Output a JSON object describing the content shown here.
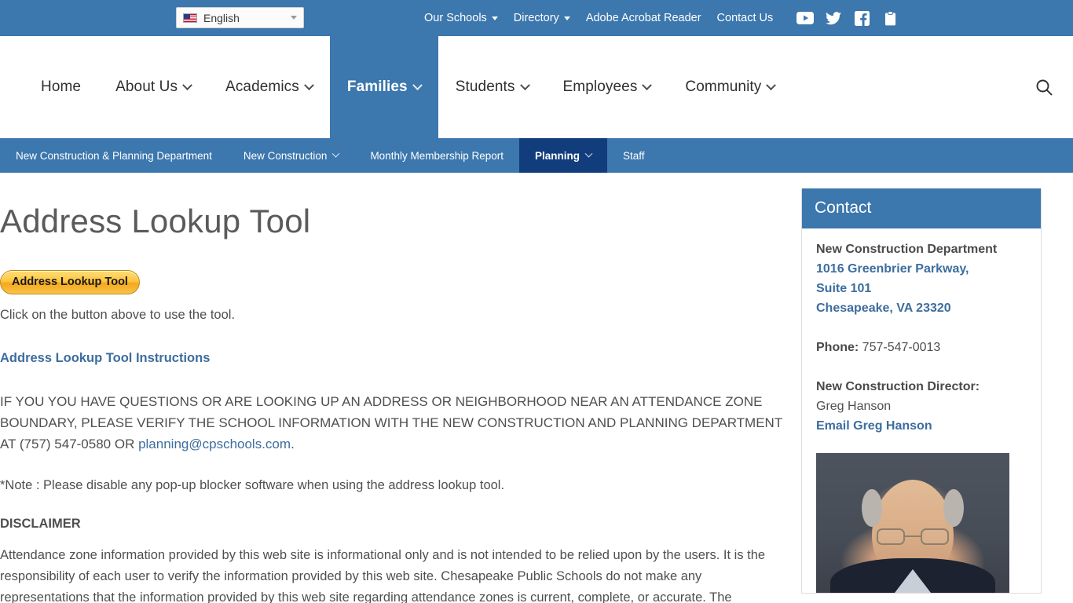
{
  "topbar": {
    "language": {
      "label": "English",
      "flag_icon": "us-flag-icon"
    },
    "links": [
      {
        "label": "Our Schools",
        "has_dropdown": true
      },
      {
        "label": "Directory",
        "has_dropdown": true
      },
      {
        "label": "Adobe Acrobat Reader",
        "has_dropdown": false
      },
      {
        "label": "Contact Us",
        "has_dropdown": false
      }
    ],
    "social": [
      {
        "name": "youtube-icon"
      },
      {
        "name": "twitter-icon"
      },
      {
        "name": "facebook-icon"
      },
      {
        "name": "clipboard-icon"
      }
    ]
  },
  "mainnav": {
    "items": [
      {
        "label": "Home",
        "has_dropdown": false,
        "active": false
      },
      {
        "label": "About Us",
        "has_dropdown": true,
        "active": false
      },
      {
        "label": "Academics",
        "has_dropdown": true,
        "active": false
      },
      {
        "label": "Families",
        "has_dropdown": true,
        "active": true
      },
      {
        "label": "Students",
        "has_dropdown": true,
        "active": false
      },
      {
        "label": "Employees",
        "has_dropdown": true,
        "active": false
      },
      {
        "label": "Community",
        "has_dropdown": true,
        "active": false
      }
    ],
    "search_icon": "search-icon"
  },
  "subnav": {
    "items": [
      {
        "label": "New Construction & Planning Department",
        "has_dropdown": false,
        "active": false
      },
      {
        "label": "New Construction",
        "has_dropdown": true,
        "active": false
      },
      {
        "label": "Monthly Membership Report",
        "has_dropdown": false,
        "active": false
      },
      {
        "label": "Planning",
        "has_dropdown": true,
        "active": true
      },
      {
        "label": "Staff",
        "has_dropdown": false,
        "active": false
      }
    ]
  },
  "main": {
    "title": "Address Lookup Tool",
    "lookup_button_label": "Address Lookup Tool",
    "click_text": "Click on the button above to use the tool.",
    "instructions_link": "Address Lookup Tool Instructions",
    "notice_part1": "IF YOU YOU HAVE QUESTIONS OR ARE LOOKING UP AN ADDRESS OR NEIGHBORHOOD NEAR AN ATTENDANCE ZONE BOUNDARY, PLEASE VERIFY THE SCHOOL INFORMATION WITH THE NEW CONSTRUCTION AND PLANNING DEPARTMENT AT  (757) 547-0580 OR ",
    "notice_email": "planning@cpschools.com",
    "notice_part2": ".",
    "note": "*Note : Please disable any pop-up blocker software when using the address lookup tool.",
    "disclaimer_heading": "DISCLAIMER",
    "disclaimer_body": "Attendance zone information provided by this web site is informational only and is not intended to be relied upon by the users. It is the responsibility of each user to verify the information provided by this web site. Chesapeake Public Schools do not make any representations that the information provided by this web site regarding attendance zones is current, complete, or accurate. The"
  },
  "sidebar": {
    "widget_title": "Contact",
    "department": "New Construction Department",
    "address_line1": "1016 Greenbrier Parkway,",
    "address_line2": "Suite 101",
    "address_line3": "Chesapeake, VA 23320",
    "phone_label": "Phone:",
    "phone_value": "757-547-0013",
    "director_label": "New Construction Director:",
    "director_name": "Greg Hanson",
    "director_email_link": "Email Greg Hanson",
    "portrait_name": "director-portrait"
  },
  "colors": {
    "header_blue": "#3c77ad",
    "active_navy": "#123d7c",
    "link_blue": "#3d6d9e",
    "button_gold": "#fdc63f",
    "body_text": "#4f4f4f"
  }
}
